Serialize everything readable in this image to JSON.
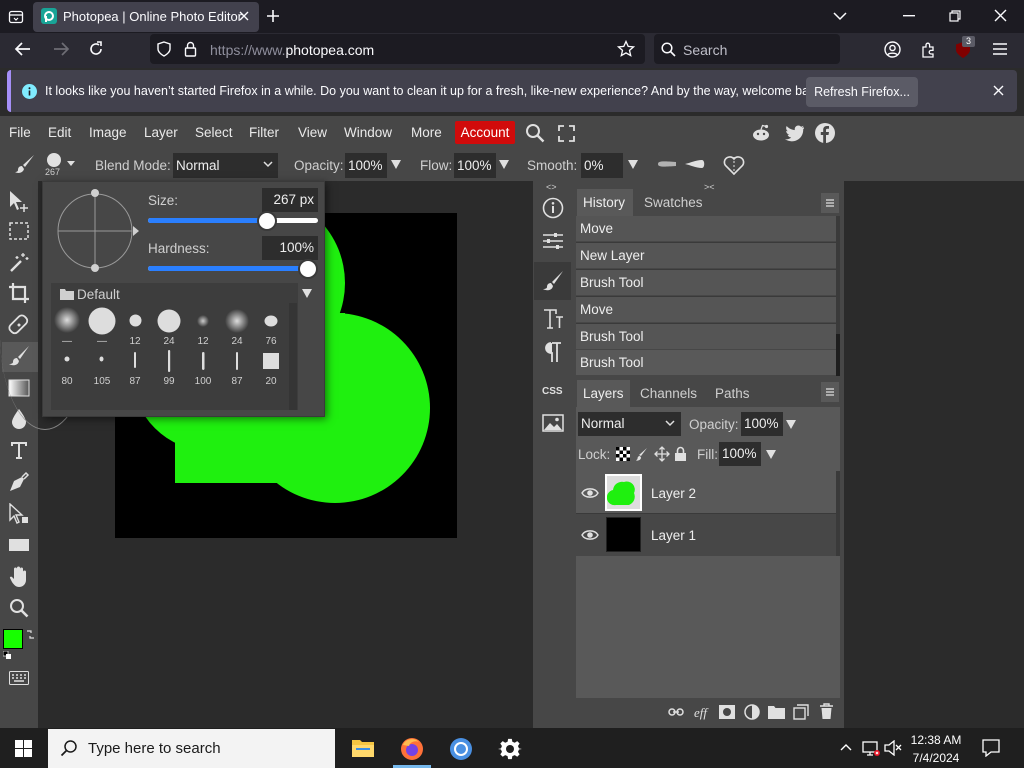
{
  "browser": {
    "tab_title": "Photopea | Online Photo Editor",
    "url_prefix": "https://www.",
    "url_domain": "photopea.com",
    "search_placeholder": "Search",
    "extension_badge": "3",
    "notification_text": "It looks like you haven’t started Firefox in a while. Do you want to clean it up for a fresh, like-new experience? And by the way, welcome back!",
    "refresh_button": "Refresh Firefox..."
  },
  "menubar": {
    "items": [
      "File",
      "Edit",
      "Image",
      "Layer",
      "Select",
      "Filter",
      "View",
      "Window",
      "More"
    ],
    "account": "Account"
  },
  "options": {
    "brush_size_badge": "267",
    "blend_mode_label": "Blend Mode:",
    "blend_mode_value": "Normal",
    "opacity_label": "Opacity:",
    "opacity_value": "100%",
    "flow_label": "Flow:",
    "flow_value": "100%",
    "smooth_label": "Smooth:",
    "smooth_value": "0%"
  },
  "brush_popup": {
    "size_label": "Size:",
    "size_value": "267",
    "size_unit": "px",
    "size_fraction": 0.7,
    "hardness_label": "Hardness:",
    "hardness_value": "100%",
    "hardness_fraction": 1.0,
    "preset_group": "Default",
    "presets_row1": [
      "—",
      "—",
      "12",
      "24",
      "12",
      "24",
      "76"
    ],
    "presets_row2": [
      "80",
      "105",
      "87",
      "99",
      "100",
      "87",
      "20"
    ]
  },
  "history_panel": {
    "tabs": [
      "History",
      "Swatches"
    ],
    "items": [
      "Move",
      "New Layer",
      "Brush Tool",
      "Move",
      "Brush Tool",
      "Brush Tool"
    ]
  },
  "layers_panel": {
    "tabs": [
      "Layers",
      "Channels",
      "Paths"
    ],
    "blend_mode": "Normal",
    "opacity_label": "Opacity:",
    "opacity_value": "100%",
    "lock_label": "Lock:",
    "fill_label": "Fill:",
    "fill_value": "100%",
    "layers": [
      "Layer 2",
      "Layer 1"
    ]
  },
  "mid_column": {
    "css_label": "CSS"
  },
  "colors": {
    "foreground": "#17ff00",
    "background": "#ffffff",
    "shape": "#1ff00f",
    "accent_red": "#d10b0b"
  },
  "taskbar": {
    "search_placeholder": "Type here to search",
    "time": "12:38 AM",
    "date": "7/4/2024"
  }
}
